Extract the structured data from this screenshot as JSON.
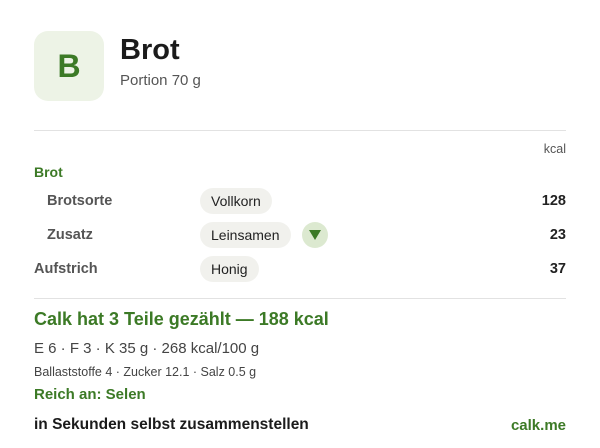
{
  "header": {
    "badge_letter": "B",
    "title": "Brot",
    "portion": "Portion 70 g"
  },
  "table": {
    "kcal_header": "kcal",
    "group_label": "Brot",
    "rows": [
      {
        "label": "Brotsorte",
        "choice": "Vollkorn",
        "kcal": "128"
      },
      {
        "label": "Zusatz",
        "choice": "Leinsamen",
        "kcal": "23"
      },
      {
        "label": "Aufstrich",
        "choice": "Honig",
        "kcal": "37"
      }
    ]
  },
  "summary": {
    "headline": "Calk hat 3 Teile gezählt — 188 kcal",
    "macros": "E 6 · F 3 · K 35 g   ·   268 kcal/100 g",
    "details": "Ballaststoffe 4 · Zucker 12.1 · Salz 0.5 g",
    "rich_in": "Reich an: Selen"
  },
  "footer": {
    "cta": "in Sekunden selbst zusammenstellen",
    "brand": "calk.me"
  },
  "icons": {
    "dropdown": "chevron-down-icon"
  },
  "colors": {
    "accent": "#3c7a26",
    "badge_bg": "#edf3e6",
    "pill_bg": "#f1f1ed",
    "dropdown_bg": "#dce9d0"
  }
}
